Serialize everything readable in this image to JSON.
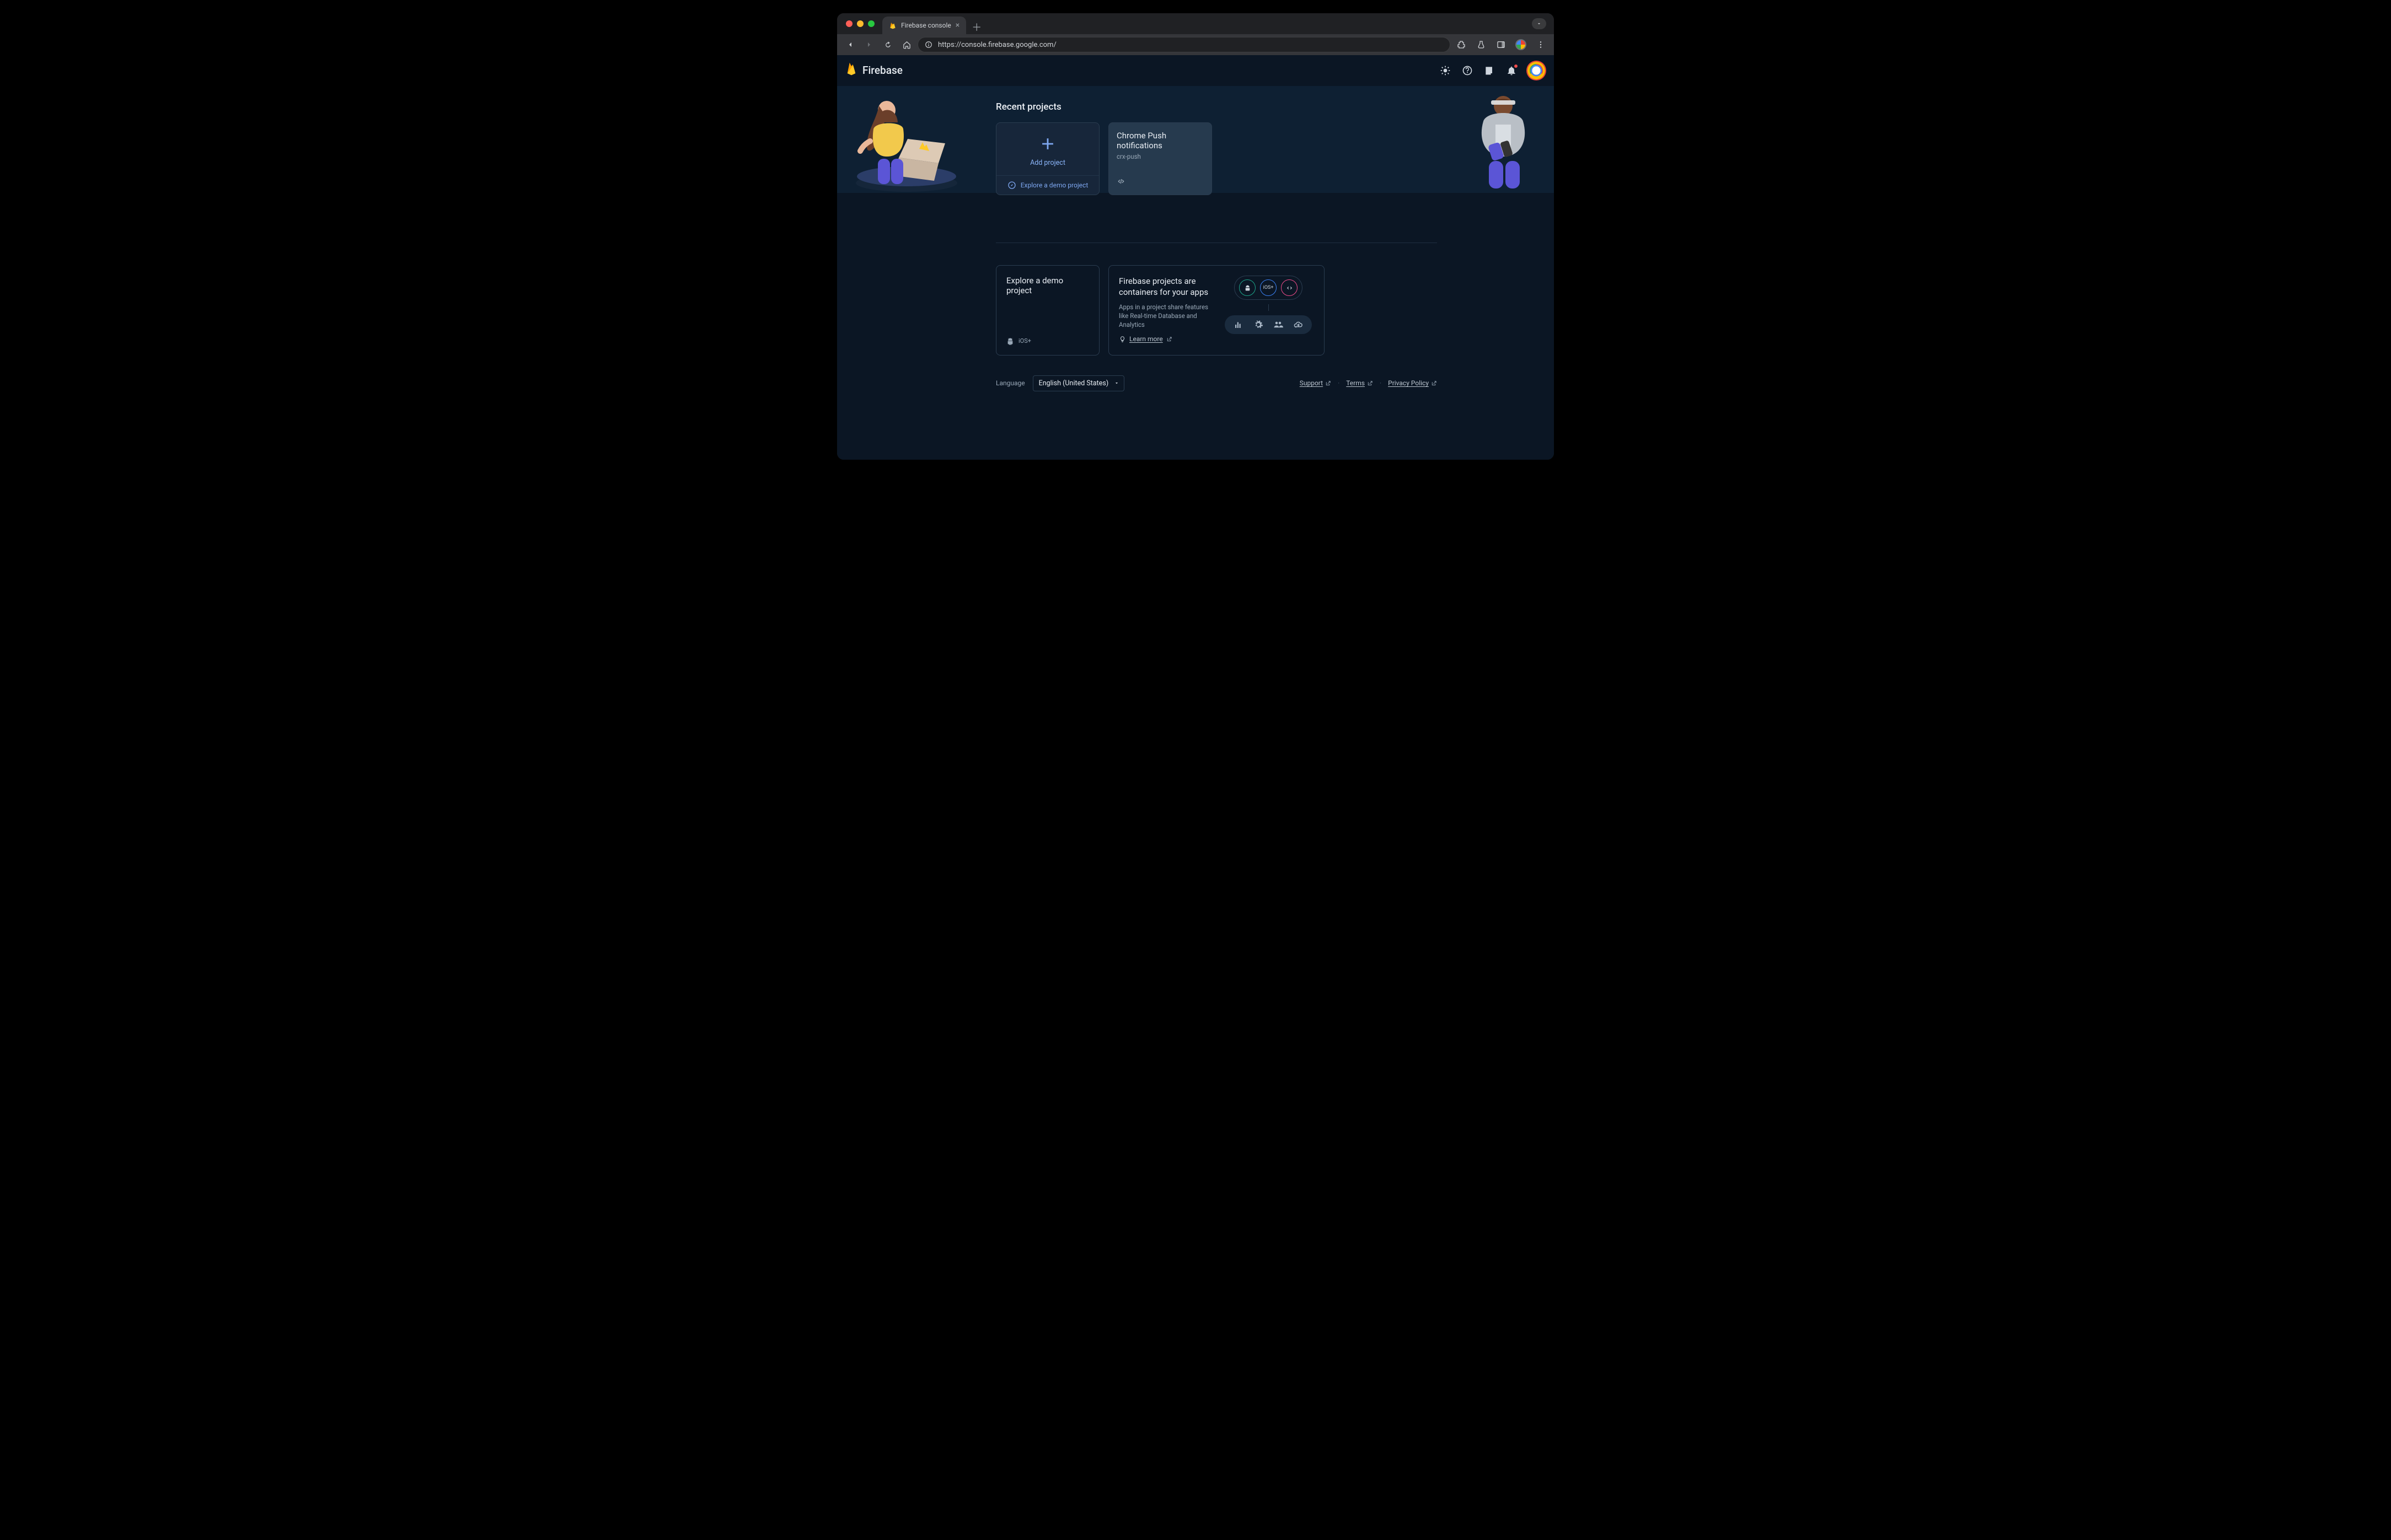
{
  "browser": {
    "tab_title": "Firebase console",
    "url": "https://console.firebase.google.com/"
  },
  "header": {
    "brand": "Firebase"
  },
  "hero": {
    "title": "Recent projects",
    "add_project_label": "Add project",
    "explore_demo_label": "Explore a demo project",
    "projects": [
      {
        "name": "Chrome Push notifications",
        "id": "crx-push"
      }
    ]
  },
  "body": {
    "explore": {
      "title": "Explore a demo project",
      "ios_label": "iOS+"
    },
    "containers": {
      "title": "Firebase projects are containers for your apps",
      "desc": "Apps in a project share features like Real-time Database and Analytics",
      "learn_more": "Learn more",
      "chip_ios": "iOS+"
    }
  },
  "footer": {
    "language_label": "Language",
    "language_value": "English (United States)",
    "support": "Support",
    "terms": "Terms",
    "privacy": "Privacy Policy"
  }
}
